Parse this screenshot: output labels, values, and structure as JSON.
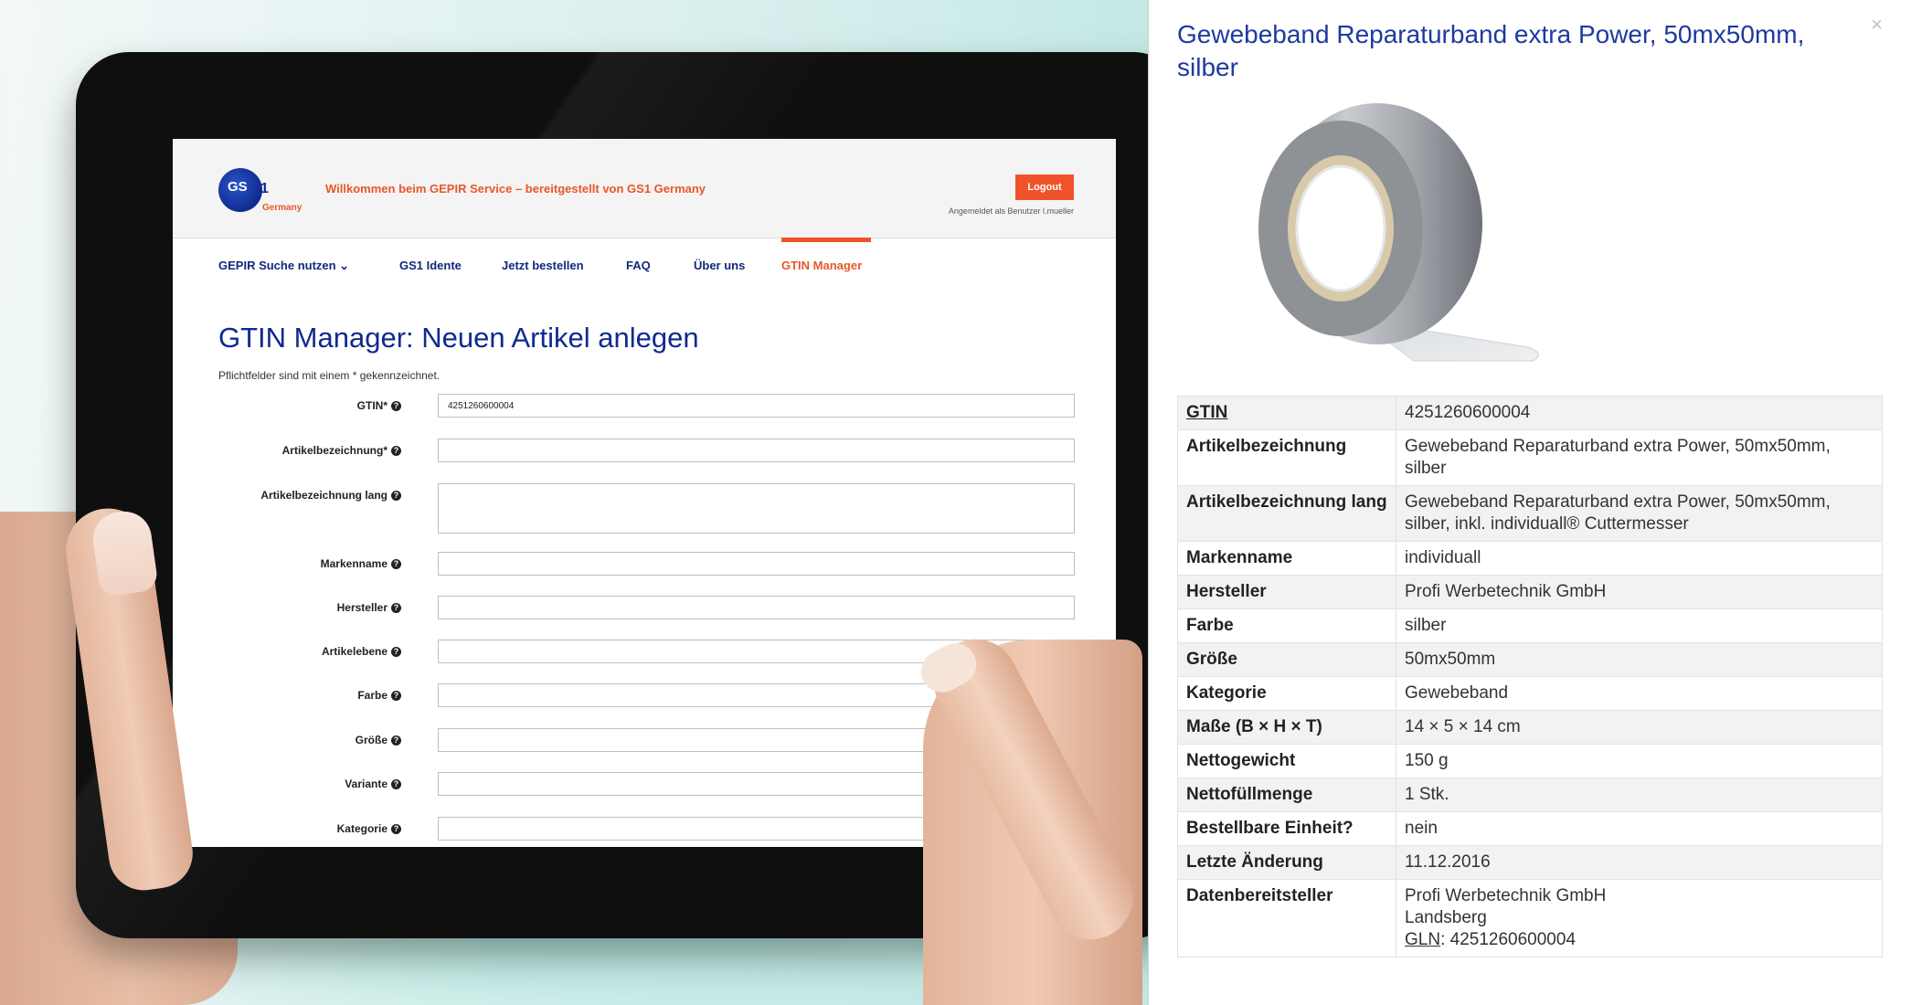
{
  "tablet": {
    "brand": {
      "logo_text": "GS",
      "logo_suffix": "1",
      "region": "Germany"
    },
    "welcome": "Willkommen beim GEPIR Service – bereitgestellt von GS1 Germany",
    "logout_label": "Logout",
    "logged_in_as": "Angemeldet als Benutzer l.mueller",
    "nav": [
      {
        "label": "GEPIR Suche nutzen ⌄"
      },
      {
        "label": "GS1 Idente"
      },
      {
        "label": "Jetzt bestellen"
      },
      {
        "label": "FAQ"
      },
      {
        "label": "Über uns"
      },
      {
        "label": "GTIN Manager",
        "active": true
      }
    ],
    "page_title": "GTIN Manager: Neuen Artikel anlegen",
    "required_note": "Pflichtfelder sind mit einem * gekennzeichnet.",
    "fields": [
      {
        "label": "GTIN*",
        "value": "4251260600004"
      },
      {
        "label": "Artikelbezeichnung*",
        "value": ""
      },
      {
        "label": "Artikelbezeichnung lang",
        "value": ""
      },
      {
        "label": "Markenname",
        "value": ""
      },
      {
        "label": "Hersteller",
        "value": ""
      },
      {
        "label": "Artikelebene",
        "value": ""
      },
      {
        "label": "Farbe",
        "value": ""
      },
      {
        "label": "Größe",
        "value": ""
      },
      {
        "label": "Variante",
        "value": ""
      },
      {
        "label": "Kategorie",
        "value": ""
      }
    ],
    "help_glyph": "?"
  },
  "panel": {
    "title": "Gewebeband Reparaturband extra Power, 50mx50mm, silber",
    "close_glyph": "×",
    "rows": [
      {
        "key": "GTIN",
        "value": "4251260600004"
      },
      {
        "key": "Artikelbezeichnung",
        "value": "Gewebeband Reparaturband extra Power, 50mx50mm, silber"
      },
      {
        "key": "Artikelbezeichnung lang",
        "value": "Gewebeband Reparaturband extra Power, 50mx50mm, silber, inkl. individuall® Cuttermesser"
      },
      {
        "key": "Markenname",
        "value": "individuall"
      },
      {
        "key": "Hersteller",
        "value": "Profi Werbetechnik GmbH"
      },
      {
        "key": "Farbe",
        "value": "silber"
      },
      {
        "key": "Größe",
        "value": "50mx50mm"
      },
      {
        "key": "Kategorie",
        "value": "Gewebeband"
      },
      {
        "key": "Maße (B × H × T)",
        "value": "14 × 5 × 14 cm"
      },
      {
        "key": "Nettogewicht",
        "value": "150 g"
      },
      {
        "key": "Nettofüllmenge",
        "value": "1 Stk."
      },
      {
        "key": "Bestellbare Einheit?",
        "value": "nein"
      },
      {
        "key": "Letzte Änderung",
        "value": "11.12.2016"
      }
    ],
    "provider": {
      "key": "Datenbereitsteller",
      "name": "Profi Werbetechnik GmbH",
      "city": "Landsberg",
      "gln_label": "GLN",
      "gln_value": ": 4251260600004"
    }
  },
  "colors": {
    "accent_orange": "#f0532b",
    "brand_blue": "#0f2a8f",
    "panel_title_blue": "#1e3aa0"
  }
}
